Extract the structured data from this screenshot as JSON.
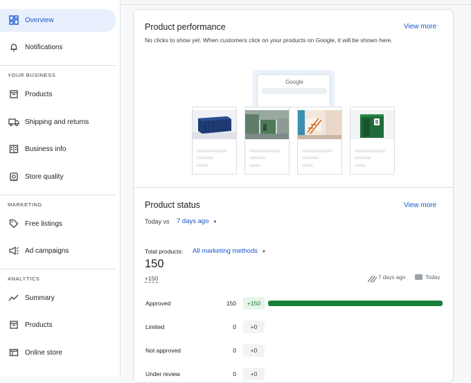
{
  "sidebar": {
    "overview": "Overview",
    "notifications": "Notifications",
    "section_business": "YOUR BUSINESS",
    "products": "Products",
    "shipping": "Shipping and returns",
    "business_info": "Business info",
    "store_quality": "Store quality",
    "section_marketing": "MARKETING",
    "free_listings": "Free listings",
    "ad_campaigns": "Ad campaigns",
    "section_analytics": "ANALYTICS",
    "summary": "Summary",
    "analytics_products": "Products",
    "online_store": "Online store"
  },
  "performance": {
    "title": "Product performance",
    "view_more": "View more",
    "subtitle": "No clicks to show yet. When customers click on your products on Google, it will be shown here.",
    "google_logo": "Google"
  },
  "status": {
    "title": "Product status",
    "view_more": "View more",
    "compare_prefix": "Today vs",
    "compare_period": "7 days ago",
    "total_label": "Total products:",
    "total_method": "All marketing methods",
    "total_value": "150",
    "total_delta": "+150",
    "legend_previous": "7 days ago",
    "legend_today": "Today",
    "rows": [
      {
        "label": "Approved",
        "value": "150",
        "delta": "+150",
        "fraction": 1.0
      },
      {
        "label": "Limited",
        "value": "0",
        "delta": "+0",
        "fraction": 0
      },
      {
        "label": "Not approved",
        "value": "0",
        "delta": "+0",
        "fraction": 0
      },
      {
        "label": "Under review",
        "value": "0",
        "delta": "+0",
        "fraction": 0
      }
    ]
  },
  "colors": {
    "accent": "#1a56c8",
    "active_bg": "#e8f0fe",
    "approved_bar": "#188038",
    "positive_delta_bg": "#e6f4ea"
  }
}
